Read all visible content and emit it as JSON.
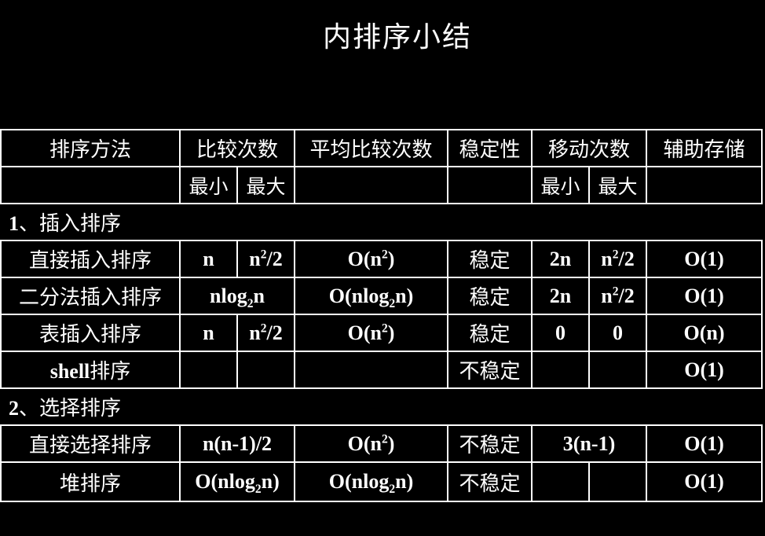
{
  "title": "内排序小结",
  "headers": {
    "method": "排序方法",
    "compare": "比较次数",
    "avg_compare": "平均比较次数",
    "stability": "稳定性",
    "move": "移动次数",
    "aux": "辅助存储",
    "min": "最小",
    "max": "最大"
  },
  "sections": [
    {
      "num": "1",
      "sep": "、",
      "name": "插入排序",
      "rows": [
        {
          "name": "直接插入排序",
          "cmp_min": "n",
          "cmp_max": [
            "n",
            "2",
            "/2"
          ],
          "avg": [
            "O(n",
            "2",
            ")"
          ],
          "stable": "稳定",
          "mv_min": "2n",
          "mv_max": [
            "n",
            "2",
            "/2"
          ],
          "aux": "O(1)"
        },
        {
          "name": "二分法插入排序",
          "cmp": [
            "nlog",
            "2",
            "n"
          ],
          "avg": [
            "O(nlog",
            "2",
            "n)"
          ],
          "stable": "稳定",
          "mv_min": "2n",
          "mv_max": [
            "n",
            "2",
            "/2"
          ],
          "aux": "O(1)"
        },
        {
          "name": "表插入排序",
          "cmp_min": "n",
          "cmp_max": [
            "n",
            "2",
            "/2"
          ],
          "avg": [
            "O(n",
            "2",
            ")"
          ],
          "stable": "稳定",
          "mv_min": "0",
          "mv_max": "0",
          "aux": "O(n)"
        },
        {
          "name_latin": "shell",
          "name_cn": "排序",
          "stable": "不稳定",
          "aux": "O(1)"
        }
      ]
    },
    {
      "num": "2",
      "sep": "、",
      "name": "选择排序",
      "rows": [
        {
          "name": "直接选择排序",
          "cmp": "n(n-1)/2",
          "avg": [
            "O(n",
            "2",
            ")"
          ],
          "stable": "不稳定",
          "mv": "3(n-1)",
          "aux": "O(1)"
        },
        {
          "name": "堆排序",
          "cmp": [
            "O(nlog",
            "2",
            "n)"
          ],
          "avg": [
            "O(nlog",
            "2",
            "n)"
          ],
          "stable": "不稳定",
          "aux": "O(1)"
        }
      ]
    }
  ]
}
